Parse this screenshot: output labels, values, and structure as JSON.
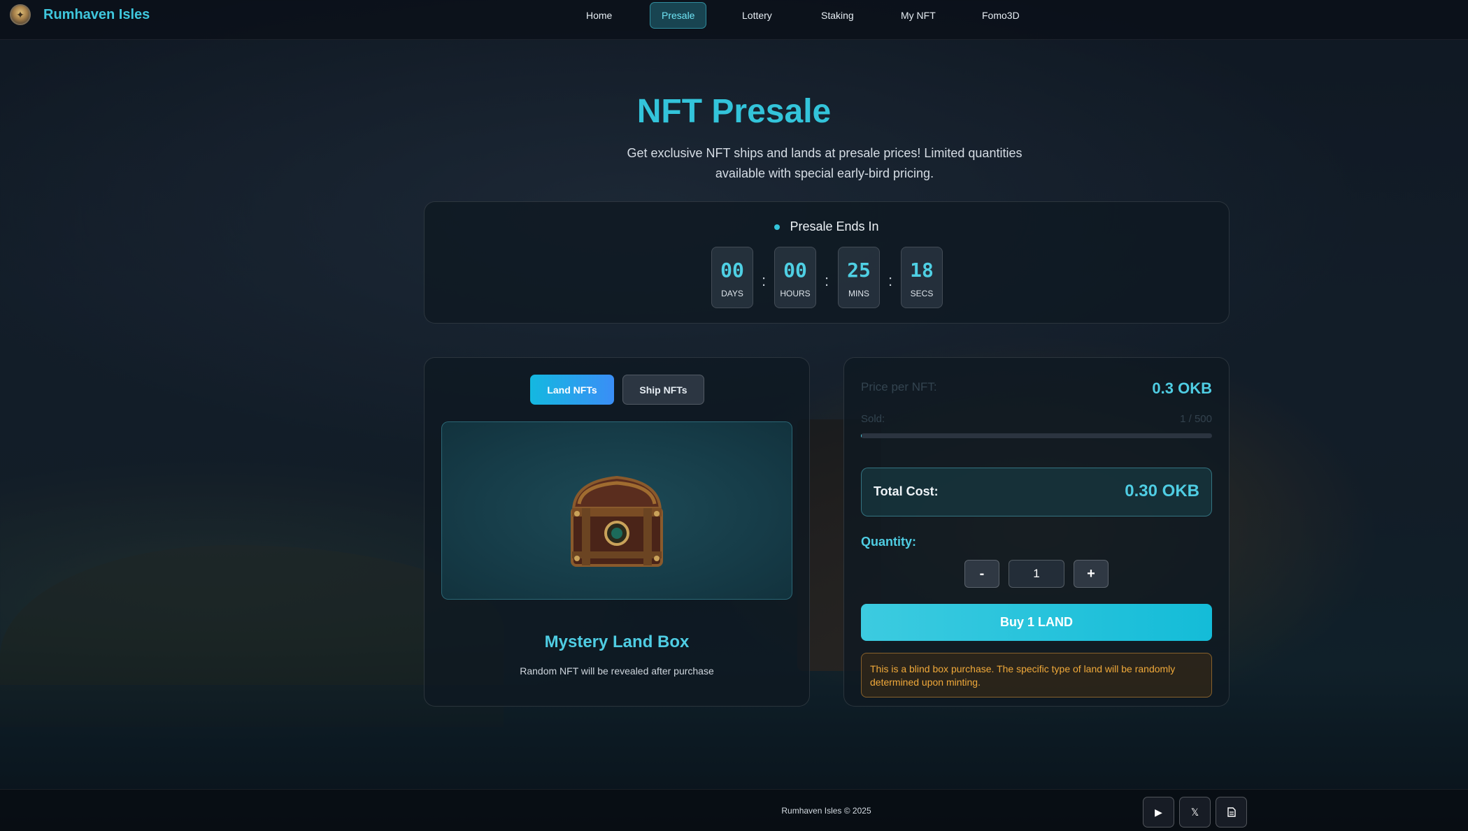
{
  "brand": {
    "name": "Rumhaven Isles",
    "logo_icon": "compass-icon"
  },
  "nav": {
    "items": [
      {
        "label": "Home",
        "active": false
      },
      {
        "label": "Presale",
        "active": true
      },
      {
        "label": "Lottery",
        "active": false
      },
      {
        "label": "Staking",
        "active": false
      },
      {
        "label": "My NFT",
        "active": false
      },
      {
        "label": "Fomo3D",
        "active": false
      }
    ]
  },
  "hero": {
    "title": "NFT Presale",
    "subtitle": "Get exclusive NFT ships and lands at presale prices! Limited quantities available with special early-bird pricing."
  },
  "countdown": {
    "title": "Presale Ends In",
    "units": [
      {
        "value": "00",
        "label": "DAYS"
      },
      {
        "value": "00",
        "label": "HOURS"
      },
      {
        "value": "25",
        "label": "MINS"
      },
      {
        "value": "18",
        "label": "SECS"
      }
    ],
    "separator": ":"
  },
  "nft": {
    "tabs": [
      {
        "label": "Land NFTs",
        "active": true
      },
      {
        "label": "Ship NFTs",
        "active": false
      }
    ],
    "image_icon": "treasure-chest-icon",
    "name": "Mystery Land Box",
    "description": "Random NFT will be revealed after purchase"
  },
  "purchase": {
    "price_label": "Price per NFT:",
    "price_value": "0.3 OKB",
    "sold_label": "Sold:",
    "sold_value": "1 / 500",
    "sold_fraction": 0.002,
    "total_label": "Total Cost:",
    "total_value": "0.30 OKB",
    "quantity_label": "Quantity:",
    "decrement_label": "-",
    "increment_label": "+",
    "quantity_value": "1",
    "buy_label": "Buy 1 LAND",
    "notice": "This is a blind box purchase. The specific type of land will be randomly determined upon minting."
  },
  "footer": {
    "copyright": "Rumhaven Isles © 2025",
    "social_icons": [
      "play-icon",
      "x-icon",
      "document-icon"
    ]
  },
  "colors": {
    "accent": "#33c4da",
    "warning": "#f0a93a"
  }
}
